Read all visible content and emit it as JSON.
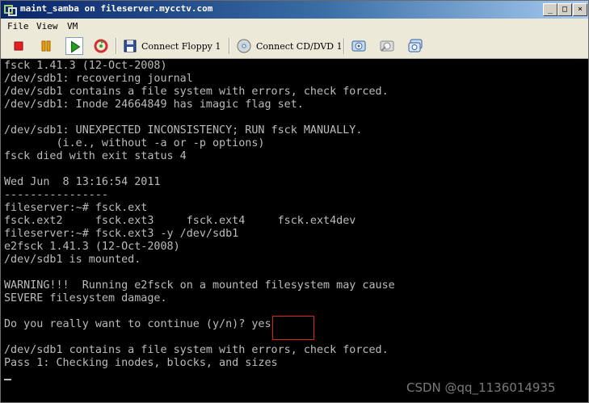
{
  "window": {
    "title": "maint_samba on fileserver.mycctv.com",
    "controls": {
      "minimize": "_",
      "maximize": "□",
      "close": "×"
    }
  },
  "menu": {
    "items": [
      "File",
      "View",
      "VM"
    ]
  },
  "toolbar": {
    "buttons": [
      {
        "icon": "stop-icon",
        "color": "#e02020"
      },
      {
        "icon": "pause-icon",
        "color": "#e8a000"
      },
      {
        "icon": "play-icon",
        "color": "#22a022"
      },
      {
        "icon": "reset-icon",
        "color": "#d03030"
      }
    ],
    "connect_floppy": "Connect Floppy 1",
    "connect_cddvd": "Connect CD/DVD 1",
    "snapshot_icons": [
      "snapshot-icon",
      "revert-snapshot-icon",
      "manage-snapshots-icon"
    ]
  },
  "console": {
    "lines": [
      "fsck 1.41.3 (12-Oct-2008)",
      "/dev/sdb1: recovering journal",
      "/dev/sdb1 contains a file system with errors, check forced.",
      "/dev/sdb1: Inode 24664849 has imagic flag set.",
      "",
      "/dev/sdb1: UNEXPECTED INCONSISTENCY; RUN fsck MANUALLY.",
      "        (i.e., without -a or -p options)",
      "fsck died with exit status 4",
      "",
      "Wed Jun  8 13:16:54 2011",
      "----------------",
      "fileserver:~# fsck.ext",
      "fsck.ext2     fsck.ext3     fsck.ext4     fsck.ext4dev",
      "fileserver:~# fsck.ext3 -y /dev/sdb1",
      "e2fsck 1.41.3 (12-Oct-2008)",
      "/dev/sdb1 is mounted.",
      "",
      "WARNING!!!  Running e2fsck on a mounted filesystem may cause",
      "SEVERE filesystem damage.",
      "",
      "Do you really want to continue (y/n)? yes",
      "",
      "/dev/sdb1 contains a file system with errors, check forced.",
      "Pass 1: Checking inodes, blocks, and sizes"
    ],
    "text_color": "#bcbcbc",
    "background": "#000000",
    "highlight_color": "#e02020"
  },
  "watermark": "CSDN @qq_1136014935"
}
